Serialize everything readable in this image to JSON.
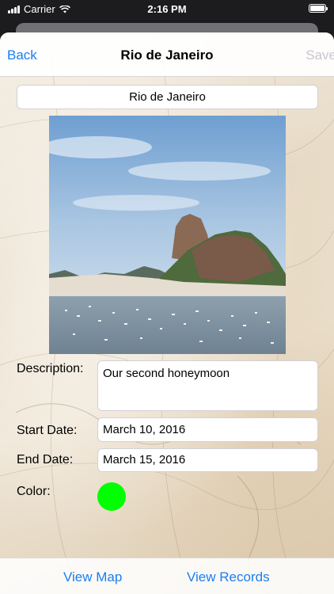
{
  "status_bar": {
    "carrier": "Carrier",
    "time": "2:16 PM"
  },
  "navbar": {
    "back_label": "Back",
    "title": "Rio de Janeiro",
    "save_label": "Save"
  },
  "form": {
    "name_value": "Rio de Janeiro",
    "description_label": "Description:",
    "description_value": "Our second honeymoon",
    "start_date_label": "Start Date:",
    "start_date_value": "March 10, 2016",
    "end_date_label": "End Date:",
    "end_date_value": "March 15, 2016",
    "color_label": "Color:",
    "color_value": "#00ff00"
  },
  "toolbar": {
    "view_map_label": "View Map",
    "view_records_label": "View Records"
  },
  "colors": {
    "accent": "#1a7ef2",
    "disabled": "#c7c7cc"
  }
}
